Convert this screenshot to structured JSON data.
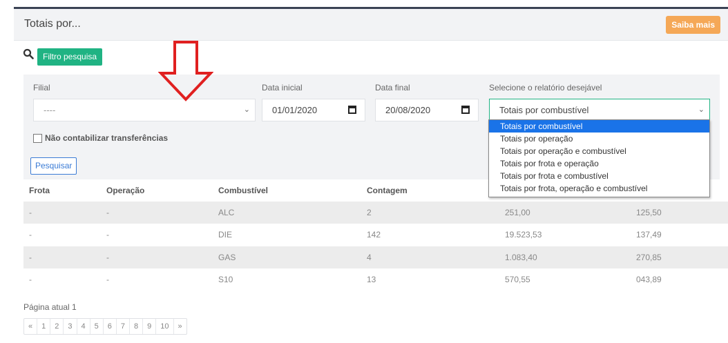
{
  "header": {
    "title": "Totais por...",
    "saiba_label": "Saiba mais"
  },
  "filter_button": {
    "label": "Filtro pesquisa"
  },
  "filters": {
    "filial_label": "Filial",
    "filial_value": "----",
    "data_inicial_label": "Data inicial",
    "data_inicial_value": "01/01/2020",
    "data_final_label": "Data final",
    "data_final_value": "20/08/2020",
    "relatorio_label": "Selecione o relatório desejável",
    "relatorio_value": "Totais por combustível",
    "checkbox_label": "Não contabilizar transferências",
    "pesquisar_label": "Pesquisar"
  },
  "dropdown": {
    "options": [
      "Totais por combustível",
      "Totais por operação",
      "Totais por operação e combustível",
      "Totais por frota e operação",
      "Totais por frota e combustível",
      "Totais por frota, operação e combustível"
    ]
  },
  "table": {
    "headers": [
      "Frota",
      "Operação",
      "Combustível",
      "Contagem"
    ],
    "rows": [
      [
        "-",
        "-",
        "ALC",
        "2",
        "251,00",
        "125,50"
      ],
      [
        "-",
        "-",
        "DIE",
        "142",
        "19.523,53",
        "137,49"
      ],
      [
        "-",
        "-",
        "GAS",
        "4",
        "1.083,40",
        "270,85"
      ],
      [
        "-",
        "-",
        "S10",
        "13",
        "570,55",
        "043,89"
      ]
    ]
  },
  "pagination": {
    "current_label": "Página atual 1",
    "items": [
      "«",
      "1",
      "2",
      "3",
      "4",
      "5",
      "6",
      "7",
      "8",
      "9",
      "10",
      "»"
    ]
  },
  "colors": {
    "accent": "#20b383",
    "saiba": "#f5a857",
    "arrow": "#e02020",
    "link": "#3a7bd5"
  }
}
